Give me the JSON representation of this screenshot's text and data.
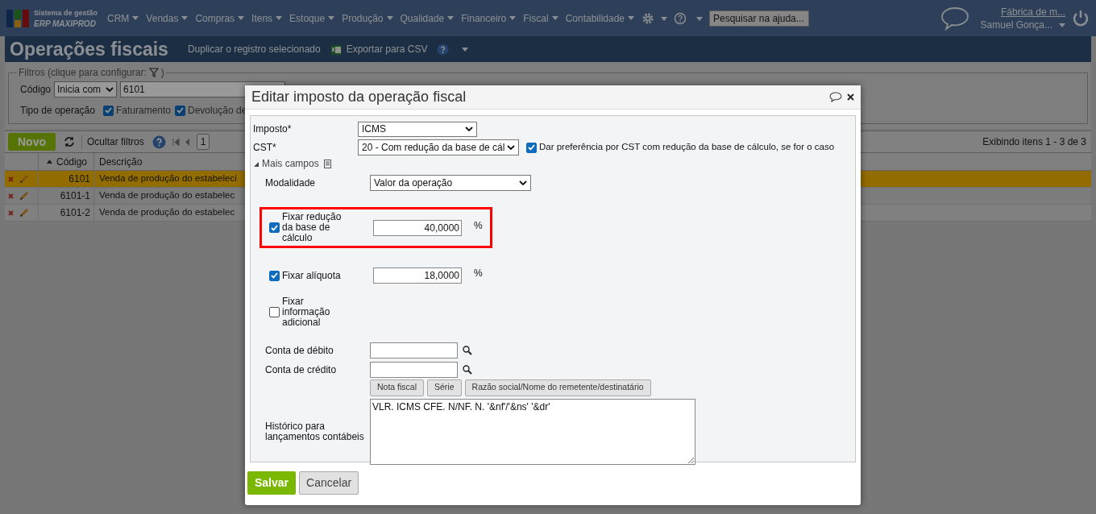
{
  "nav": {
    "logo_line1": "Sistema de gestão",
    "logo_line2": "ERP MAXIPROD",
    "menus": [
      "CRM",
      "Vendas",
      "Compras",
      "Itens",
      "Estoque",
      "Produção",
      "Qualidade",
      "Financeiro",
      "Fiscal",
      "Contabilidade"
    ],
    "search": {
      "placeholder": "Pesquisar na ajuda..."
    },
    "company": "Fábrica de m...",
    "user": "Samuel Gonça..."
  },
  "page": {
    "title": "Operações fiscais",
    "actions": [
      "Duplicar o registro selecionado",
      "Exportar para CSV"
    ]
  },
  "filters": {
    "legend_before": "Filtros (clique para configurar:",
    "legend_after": ")",
    "code_label": "Código",
    "code_mode": "Inicia com",
    "code_value": "6101",
    "type_label": "Tipo de operação",
    "types": [
      {
        "label": "Faturamento",
        "checked": true
      },
      {
        "label": "Devolução de",
        "checked": true
      }
    ]
  },
  "toolbar": {
    "new": "Novo",
    "hide_filters": "Ocultar filtros",
    "page": "1",
    "info": "Exibindo itens 1 - 3 de 3"
  },
  "table": {
    "columns": [
      "Código",
      "Descrição"
    ],
    "rows": [
      {
        "code": "6101",
        "description": "Venda de produção do estabeleci",
        "selected": true
      },
      {
        "code": "6101-1",
        "description": "Venda de produção do estabelec",
        "selected": false
      },
      {
        "code": "6101-2",
        "description": "Venda de produção do estabelec",
        "selected": false
      }
    ]
  },
  "dialog": {
    "title": "Editar imposto da operação fiscal",
    "tax_label": "Imposto*",
    "tax_value": "ICMS",
    "cst_label": "CST*",
    "cst_value": "20 - Com redução da base de cál",
    "prefer": {
      "label": "Dar preferência por CST com redução da base de cálculo, se for o caso",
      "checked": true
    },
    "more": {
      "label": "Mais campos",
      "expanded": true
    },
    "modality_label": "Modalidade",
    "modality_value": "Valor da operação",
    "fixed": [
      {
        "label": "Fixar redução da base de cálculo",
        "checked": true,
        "value": "40,0000",
        "unit": "%",
        "highlighted": true
      },
      {
        "label": "Fixar alíquota",
        "checked": true,
        "value": "18,0000",
        "unit": "%",
        "highlighted": false
      },
      {
        "label": "Fixar informação adicional",
        "checked": false
      }
    ],
    "debit_label": "Conta de débito",
    "credit_label": "Conta de crédito",
    "insert_buttons": [
      "Nota fiscal",
      "Série",
      "Razão social/Nome do remetente/destinatário"
    ],
    "history_label": "Histórico para lançamentos contábeis",
    "history_value": "VLR. ICMS CFE. N/NF. N. '&nf'/'&ns' '&dr'",
    "save": "Salvar",
    "cancel": "Cancelar"
  }
}
